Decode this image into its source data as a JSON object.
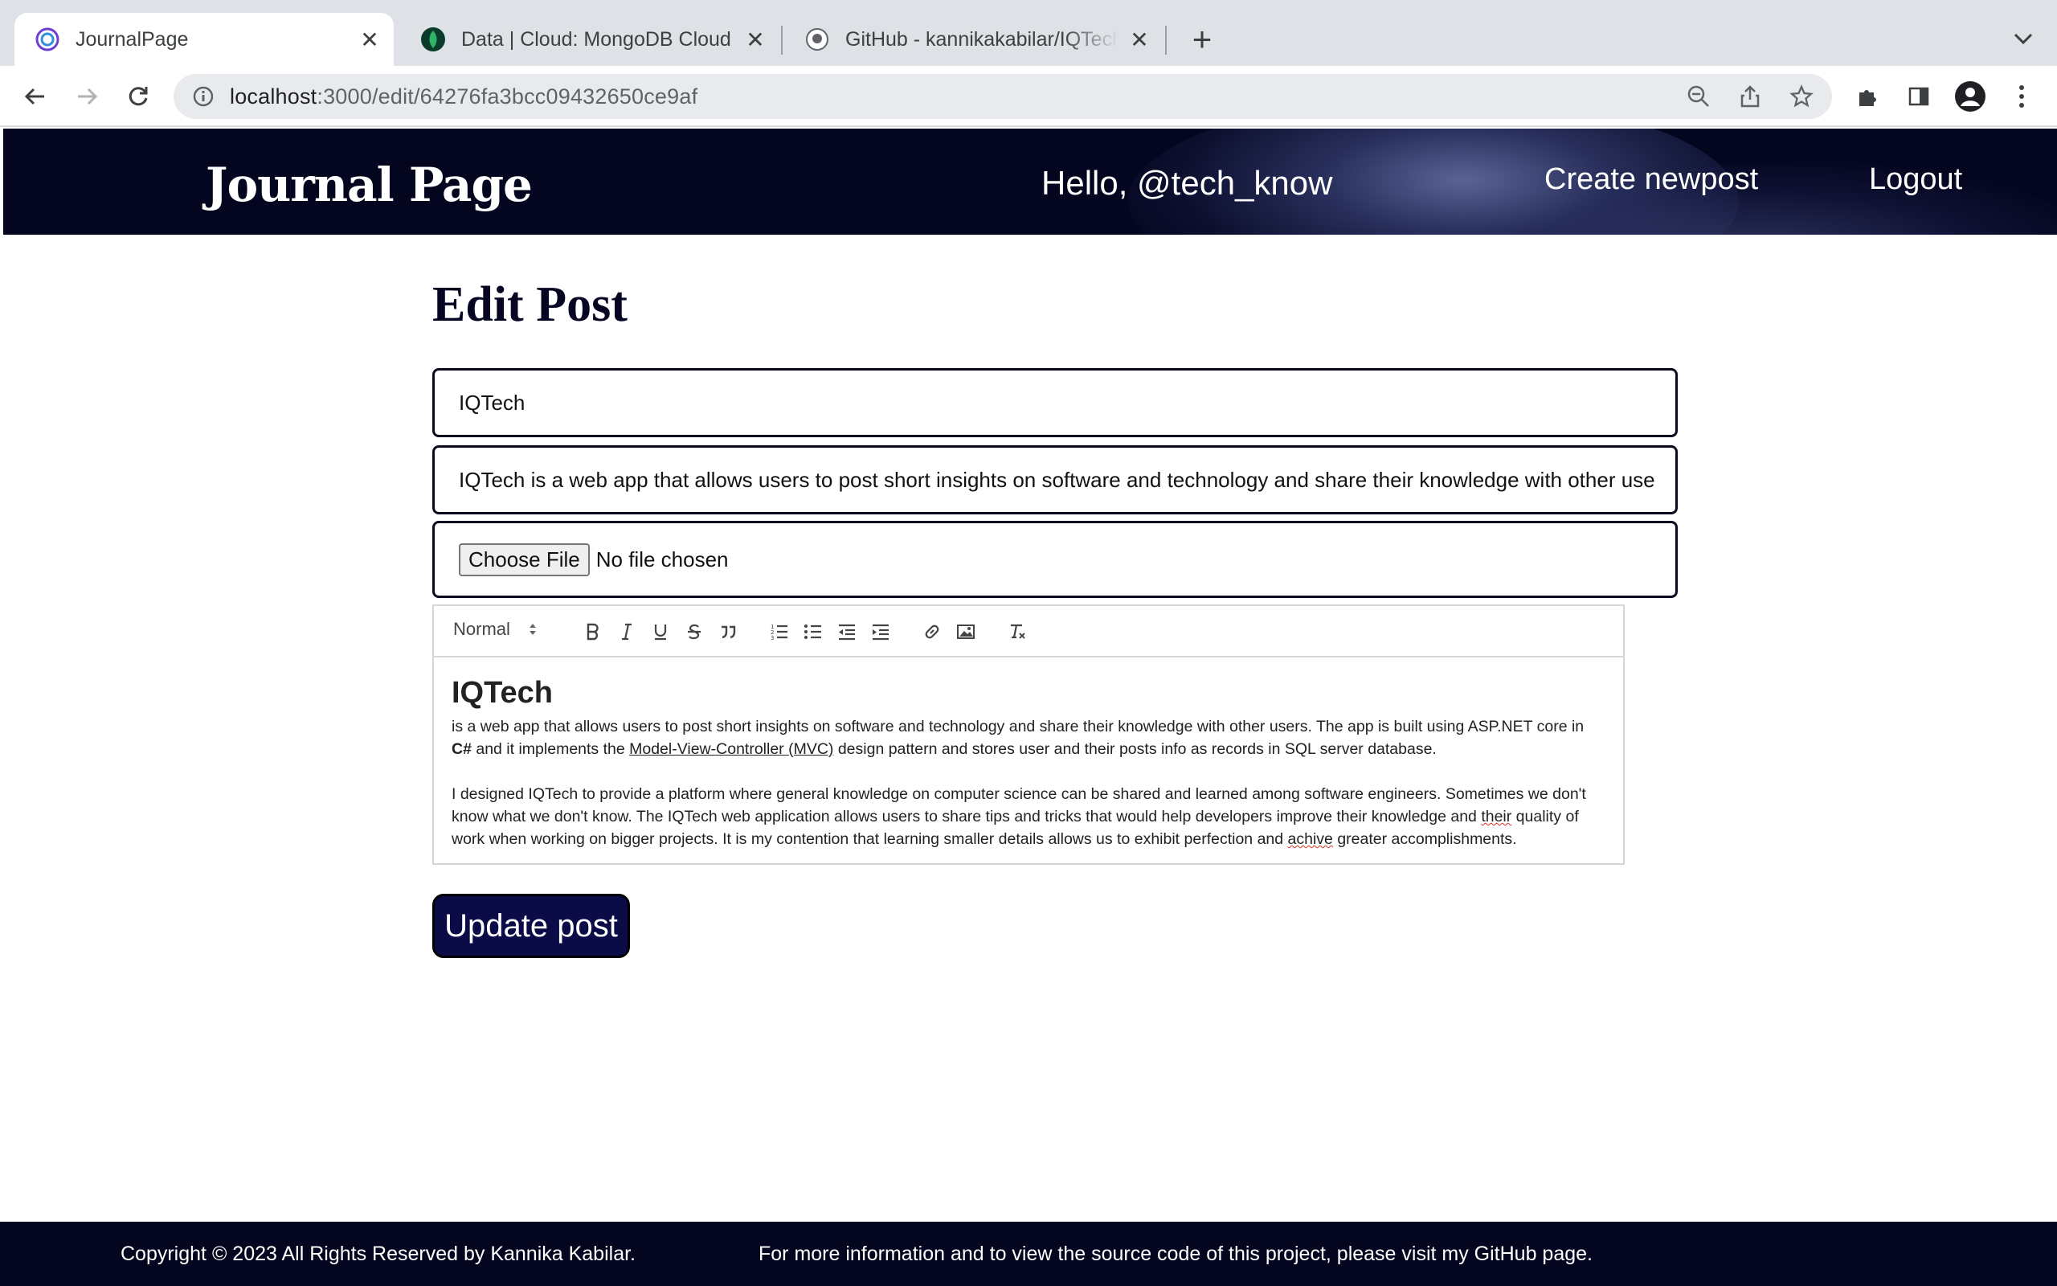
{
  "browser": {
    "tabs": [
      {
        "title": "JournalPage",
        "active": true
      },
      {
        "title": "Data | Cloud: MongoDB Cloud",
        "active": false
      },
      {
        "title": "GitHub - kannikakabilar/IQTech",
        "active": false
      }
    ],
    "url_host": "localhost",
    "url_path": ":3000/edit/64276fa3bcc09432650ce9af"
  },
  "header": {
    "logo": "Journal Page",
    "greeting": "Hello, @tech_know",
    "nav": {
      "create": "Create newpost",
      "logout": "Logout"
    }
  },
  "main": {
    "title": "Edit Post",
    "title_field_value": "IQTech",
    "summary_field_value": "IQTech is a web app that allows users to post short insights on software and technology and share their knowledge with other use",
    "file": {
      "button": "Choose File",
      "status": "No file chosen"
    },
    "editor": {
      "format_select": "Normal",
      "heading": "IQTech",
      "para1_a": "is a web app that allows users to post short insights on software and technology and share their knowledge with other users. The app is built using ASP.NET core in",
      "para1_bold": "C#",
      "para1_b": " and it implements the ",
      "para1_link": "Model-View-Controller (MVC)",
      "para1_c": " design pattern and stores user and their posts info as records in SQL server database.",
      "para2_a": "I designed IQTech to provide a platform where general knowledge on computer science can be shared and learned among software engineers. Sometimes we don't know what we don't know. The IQTech web application allows users to share tips and tricks that would help developers improve their knowledge and ",
      "para2_spell1": "their",
      "para2_b": " quality of work when working on bigger projects. It is my contention that learning smaller details allows us to exhibit perfection and ",
      "para2_spell2": "achive",
      "para2_c": " greater accomplishments."
    },
    "update_button": "Update post"
  },
  "footer": {
    "copyright": "Copyright © 2023 All Rights Reserved by Kannika Kabilar.",
    "info": "For more information and to view the source code of this project, please visit my GitHub page."
  },
  "colors": {
    "header_bg": "#04061f",
    "button_bg": "#0b0c47"
  }
}
